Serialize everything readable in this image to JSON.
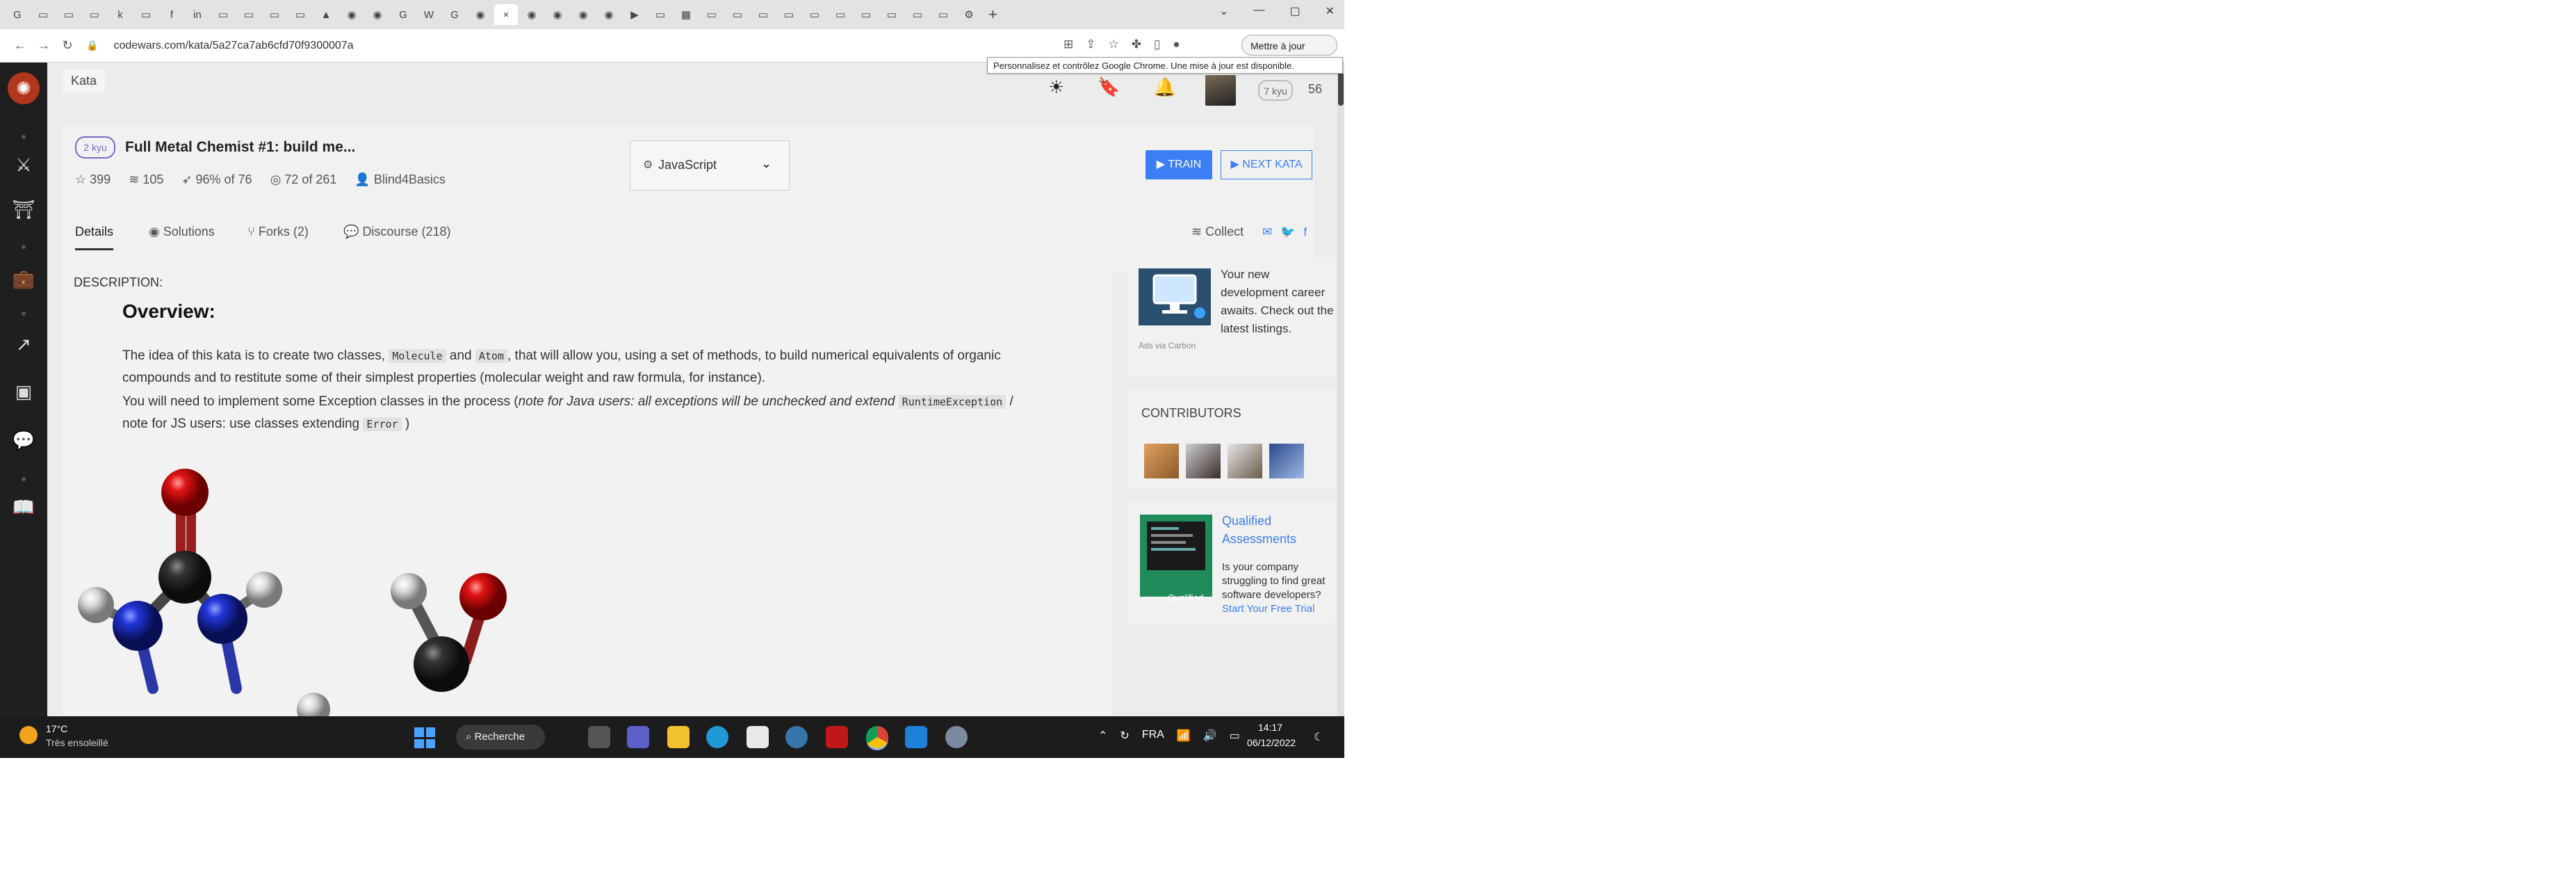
{
  "browser": {
    "tabs": [
      "G",
      "▭",
      "▭",
      "▭",
      "k",
      "▭",
      "f",
      "in",
      "▭",
      "▭",
      "▭",
      "▭",
      "▲",
      "◉",
      "◉",
      "G",
      "W",
      "G",
      "◉",
      "×",
      "◉",
      "◉",
      "◉",
      "◉",
      "▶",
      "▭",
      "▦",
      "▭",
      "▭",
      "▭",
      "▭",
      "▭",
      "▭",
      "▭",
      "▭",
      "▭",
      "▭",
      "⚙"
    ],
    "new_tab": "+",
    "url": "codewars.com/kata/5a27ca7ab6cfd70f9300007a",
    "update_button": "Mettre à jour",
    "tooltip": "Personnalisez et contrôlez Google Chrome. Une mise à jour est disponible."
  },
  "header": {
    "breadcrumb": "Kata",
    "user_rank": "7 kyu",
    "honor": "56"
  },
  "kata": {
    "rank": "2 kyu",
    "title": "Full Metal Chemist #1: build me...",
    "stats": {
      "stars": "399",
      "collections": "105",
      "satisfaction": "96%",
      "satisfaction_of": "of 76",
      "completed": "72",
      "completed_of": "of 261",
      "author": "Blind4Basics"
    },
    "language": "JavaScript",
    "train_label": "▶ TRAIN",
    "next_label": "▶ NEXT KATA"
  },
  "tabs": {
    "details": "Details",
    "solutions": "Solutions",
    "forks": "Forks (2)",
    "discourse": "Discourse (218)",
    "collect": "Collect"
  },
  "description": {
    "label": "DESCRIPTION:",
    "heading": "Overview:",
    "p1_a": "The idea of this kata is to create two classes,",
    "p1_code1": "Molecule",
    "p1_and": "and",
    "p1_code2": "Atom",
    "p1_b": ", that will allow you, using a set of methods, to build numerical equivalents of organic compounds and to restitute some of their simplest properties (molecular weight and raw formula, for instance).",
    "p2_a": "You will need to implement some Exception classes in the process (",
    "p2_italic": "note for Java users: all exceptions will be unchecked and extend",
    "p2_code1": "RuntimeException",
    "p2_b": "/ note for JS users: use classes extending",
    "p2_code2": "Error",
    "p2_c": ")"
  },
  "sidebar_right": {
    "ad1_text": "Your new development career awaits. Check out the latest listings.",
    "ad1_via": "Ads via Carbon",
    "contributors_title": "CONTRIBUTORS",
    "ad2_title": "Qualified Assessments",
    "ad2_text": "Is your company struggling to find great software developers?",
    "ad2_cta": "Start Your Free Trial",
    "ad2_img_label": "Qualified"
  },
  "taskbar": {
    "temp": "17°C",
    "weather": "Très ensoleillé",
    "search": "Recherche",
    "lang": "FRA",
    "time": "14:17",
    "date": "06/12/2022"
  },
  "colors": {
    "accent_blue": "#3c7ef3",
    "kyu_purple": "#7b69c7",
    "codewars_red": "#b1361e",
    "oxygen_red": "#d10f0f",
    "nitrogen_blue": "#1f3fd1",
    "carbon_dark": "#2a2a2a"
  }
}
